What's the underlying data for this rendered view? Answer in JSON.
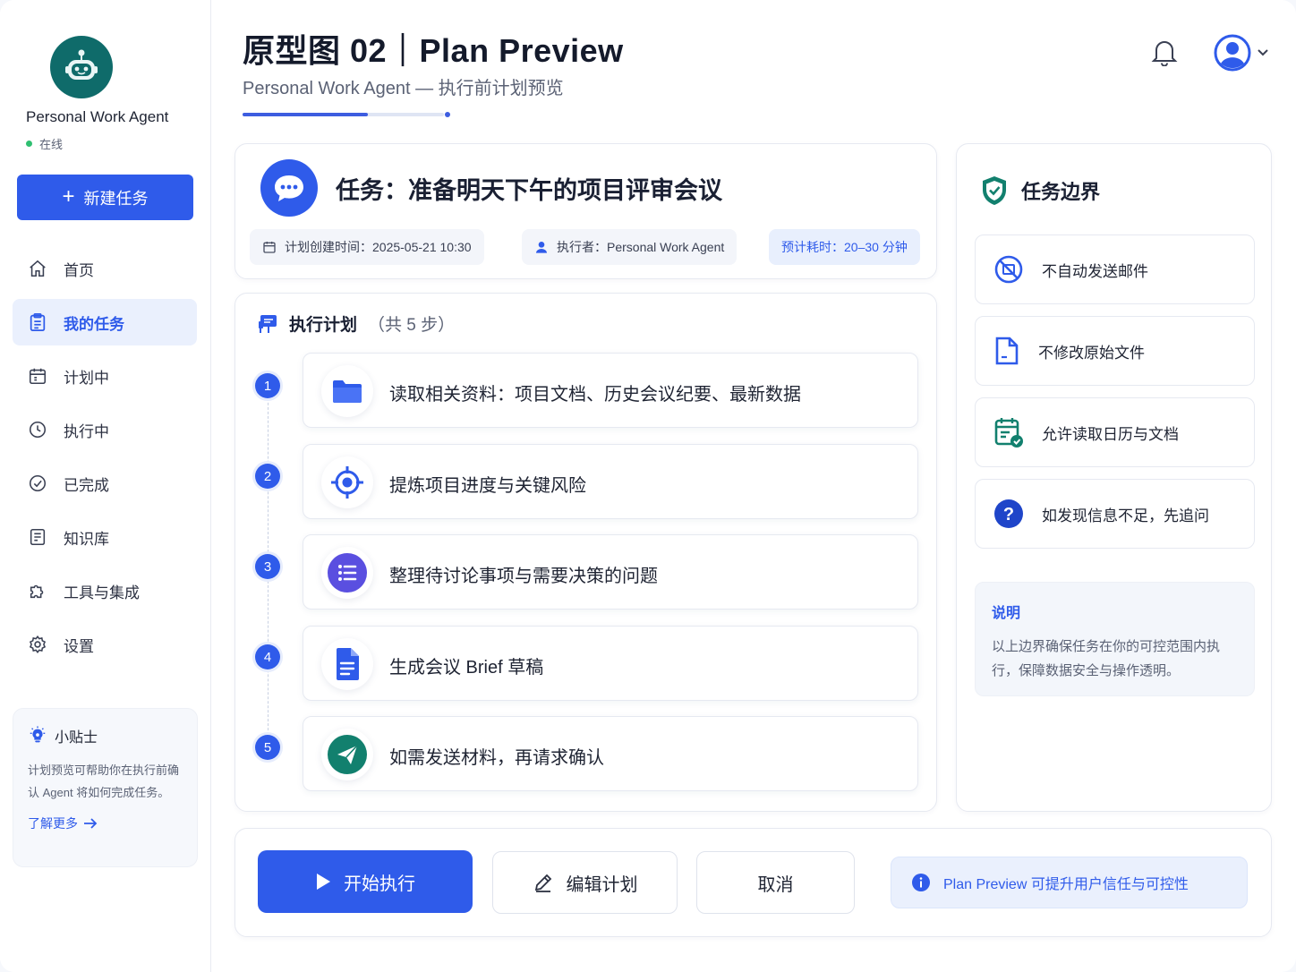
{
  "colors": {
    "primary": "#2f5bea",
    "brand_teal": "#0f6b6a",
    "online": "#2fbf71",
    "teal_icon": "#12806e",
    "purple_icon": "#5a4fe0"
  },
  "sidebar": {
    "brand_name": "Personal Work Agent",
    "status": "在线",
    "new_task_label": "新建任务",
    "items": [
      {
        "label": "首页",
        "icon": "home-icon"
      },
      {
        "label": "我的任务",
        "icon": "clipboard-icon",
        "active": true
      },
      {
        "label": "计划中",
        "icon": "calendar-icon"
      },
      {
        "label": "执行中",
        "icon": "clock-icon"
      },
      {
        "label": "已完成",
        "icon": "check-circle-icon"
      },
      {
        "label": "知识库",
        "icon": "book-icon"
      },
      {
        "label": "工具与集成",
        "icon": "puzzle-icon"
      },
      {
        "label": "设置",
        "icon": "gear-icon"
      }
    ],
    "tip": {
      "title": "小贴士",
      "body": "计划预览可帮助你在执行前确认 Agent 将如何完成任务。",
      "link": "了解更多"
    }
  },
  "header": {
    "title": "原型图 02｜Plan Preview",
    "subtitle": "Personal Work Agent — 执行前计划预览",
    "progress": 0.62
  },
  "task": {
    "title": "任务：准备明天下午的项目评审会议",
    "created": "计划创建时间：2025-05-21 10:30",
    "executor": "执行者：Personal Work Agent",
    "estimate": "预计耗时：20–30 分钟"
  },
  "plan": {
    "heading": "执行计划",
    "count": "（共 5 步）",
    "steps": [
      {
        "num": "1",
        "text": "读取相关资料：项目文档、历史会议纪要、最新数据",
        "icon": "folder-icon"
      },
      {
        "num": "2",
        "text": "提炼项目进度与关键风险",
        "icon": "target-icon"
      },
      {
        "num": "3",
        "text": "整理待讨论事项与需要决策的问题",
        "icon": "list-icon"
      },
      {
        "num": "4",
        "text": "生成会议 Brief 草稿",
        "icon": "document-icon"
      },
      {
        "num": "5",
        "text": "如需发送材料，再请求确认",
        "icon": "send-icon"
      }
    ]
  },
  "boundaries": {
    "title": "任务边界",
    "items": [
      {
        "text": "不自动发送邮件",
        "icon": "no-mail-icon"
      },
      {
        "text": "不修改原始文件",
        "icon": "file-icon"
      },
      {
        "text": "允许读取日历与文档",
        "icon": "calendar-check-icon"
      },
      {
        "text": "如发现信息不足，先追问",
        "icon": "question-icon"
      }
    ],
    "note_title": "说明",
    "note_body": "以上边界确保任务在你的可控范围内执行，保障数据安全与操作透明。"
  },
  "actions": {
    "start": "开始执行",
    "edit": "编辑计划",
    "cancel": "取消",
    "info": "Plan Preview 可提升用户信任与可控性"
  }
}
